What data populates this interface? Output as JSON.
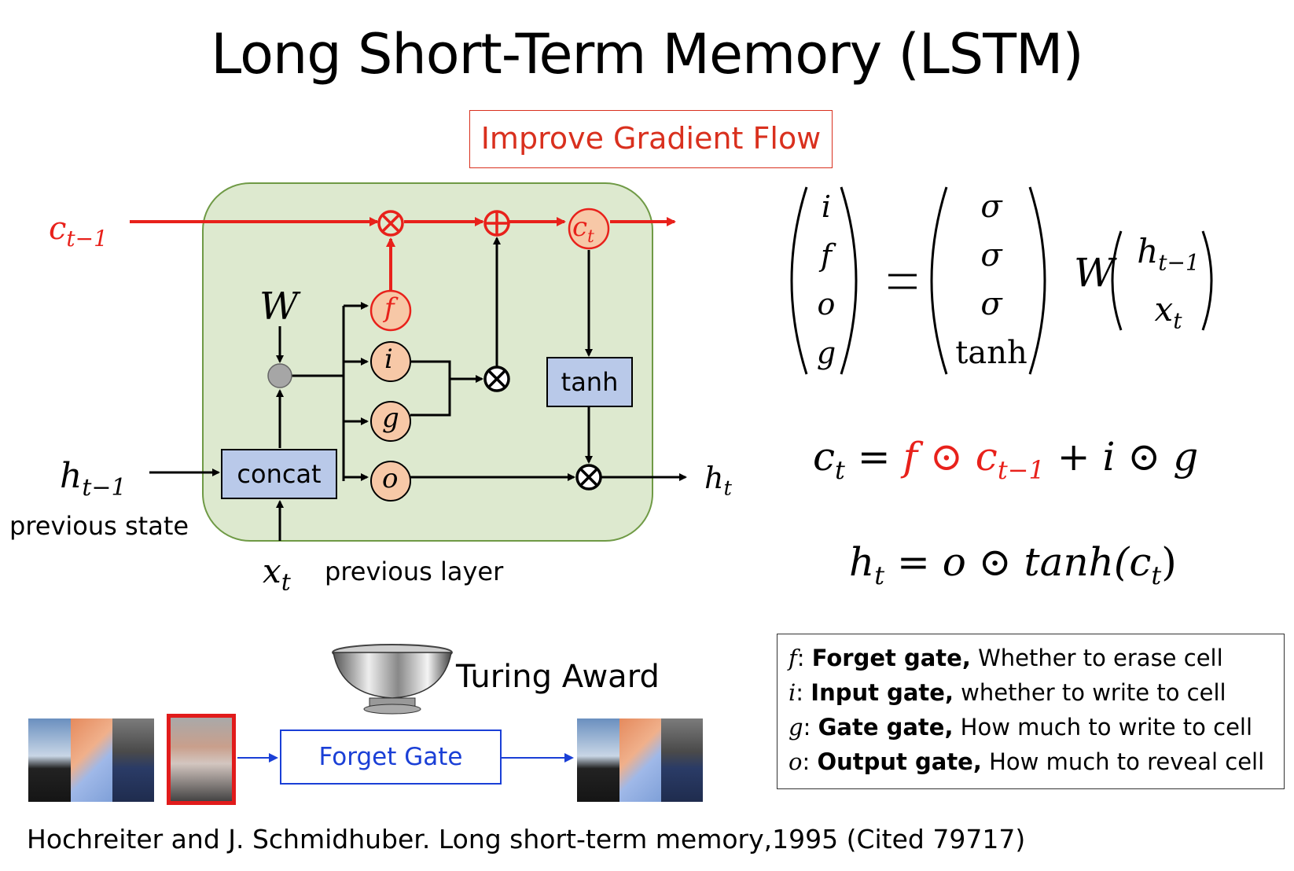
{
  "title": "Long Short-Term Memory (LSTM)",
  "callout": "Improve Gradient Flow",
  "diagram": {
    "c_prev": "c",
    "c_prev_sub": "t−1",
    "h_prev": "h",
    "h_prev_sub": "t−1",
    "x_t": "x",
    "x_t_sub": "t",
    "h_t": "h",
    "h_t_sub": "t",
    "c_t": "c",
    "c_t_sub": "t",
    "weight": "W",
    "concat_label": "concat",
    "tanh_label": "tanh",
    "gates": [
      "f",
      "i",
      "g",
      "o"
    ],
    "previous_state": "previous state",
    "previous_layer": "previous layer",
    "colors": {
      "cell_path": "#e8211b",
      "panel": "#dde9cf",
      "panel_border": "#6f9a45",
      "gate_fill": "#f7c8a7",
      "box_fill": "#b9c9e9"
    }
  },
  "equations": {
    "gate_vector": [
      "i",
      "f",
      "o",
      "g"
    ],
    "activations": [
      "σ",
      "σ",
      "σ",
      "tanh"
    ],
    "weight": "W",
    "inputs": [
      "h",
      "x"
    ],
    "input_subs": [
      "t−1",
      "t"
    ],
    "cell_eq": {
      "lhs": "c",
      "lhs_sub": "t",
      "f": "f",
      "c_prev": "c",
      "c_prev_sub": "t−1",
      "rest": "+ i ⊙ g"
    },
    "hidden_eq": {
      "lhs": "h",
      "lhs_sub": "t",
      "rhs": "= o ⊙ tanh(c",
      "rhs_sub": "t",
      "close": ")"
    }
  },
  "legend": [
    {
      "sym": "f",
      "gate": "Forget gate,",
      "desc": " Whether to erase cell"
    },
    {
      "sym": "i",
      "gate": "Input gate,",
      "desc": " whether to write to cell"
    },
    {
      "sym": "g",
      "gate": "Gate gate,",
      "desc": " How much to write to cell"
    },
    {
      "sym": "o",
      "gate": "Output gate,",
      "desc": " How much to reveal cell"
    }
  ],
  "award": {
    "label": "Turing Award",
    "forget_gate": "Forget Gate"
  },
  "citation": "Hochreiter and J. Schmidhuber. Long short-term memory,1995 (Cited 79717)"
}
